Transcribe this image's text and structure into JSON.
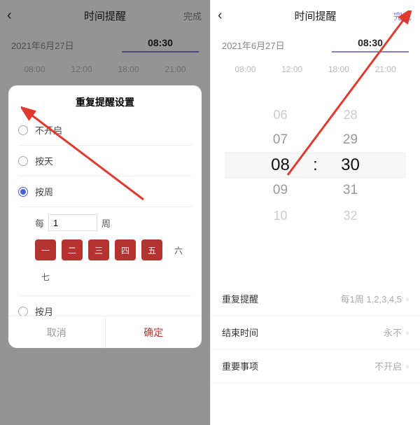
{
  "header": {
    "title": "时间提醒",
    "done": "完成"
  },
  "dt": {
    "date": "2021年6月27日",
    "time": "08:30"
  },
  "ticks": [
    "08:00",
    "12:00",
    "18:00",
    "21:00"
  ],
  "modal": {
    "title": "重复提醒设置",
    "opts": {
      "none": "不开启",
      "day": "按天",
      "week": "按周",
      "month": "按月"
    },
    "week": {
      "prefix": "每",
      "value": "1",
      "suffix": "周",
      "days": [
        {
          "label": "一",
          "on": true
        },
        {
          "label": "二",
          "on": true
        },
        {
          "label": "三",
          "on": true
        },
        {
          "label": "四",
          "on": true
        },
        {
          "label": "五",
          "on": true
        },
        {
          "label": "六",
          "on": false
        },
        {
          "label": "七",
          "on": false
        }
      ]
    },
    "cancel": "取消",
    "ok": "确定"
  },
  "picker": {
    "hours": [
      "06",
      "07",
      "08",
      "09",
      "10"
    ],
    "mins": [
      "28",
      "29",
      "30",
      "31",
      "32"
    ]
  },
  "list": {
    "repeat": {
      "label": "重复提醒",
      "value": "每1周 1,2,3,4,5"
    },
    "end": {
      "label": "结束时间",
      "value": "永不"
    },
    "important": {
      "label": "重要事项",
      "value": "不开启"
    }
  },
  "colors": {
    "accent": "#b4332f",
    "purple": "#8a7ad9"
  }
}
